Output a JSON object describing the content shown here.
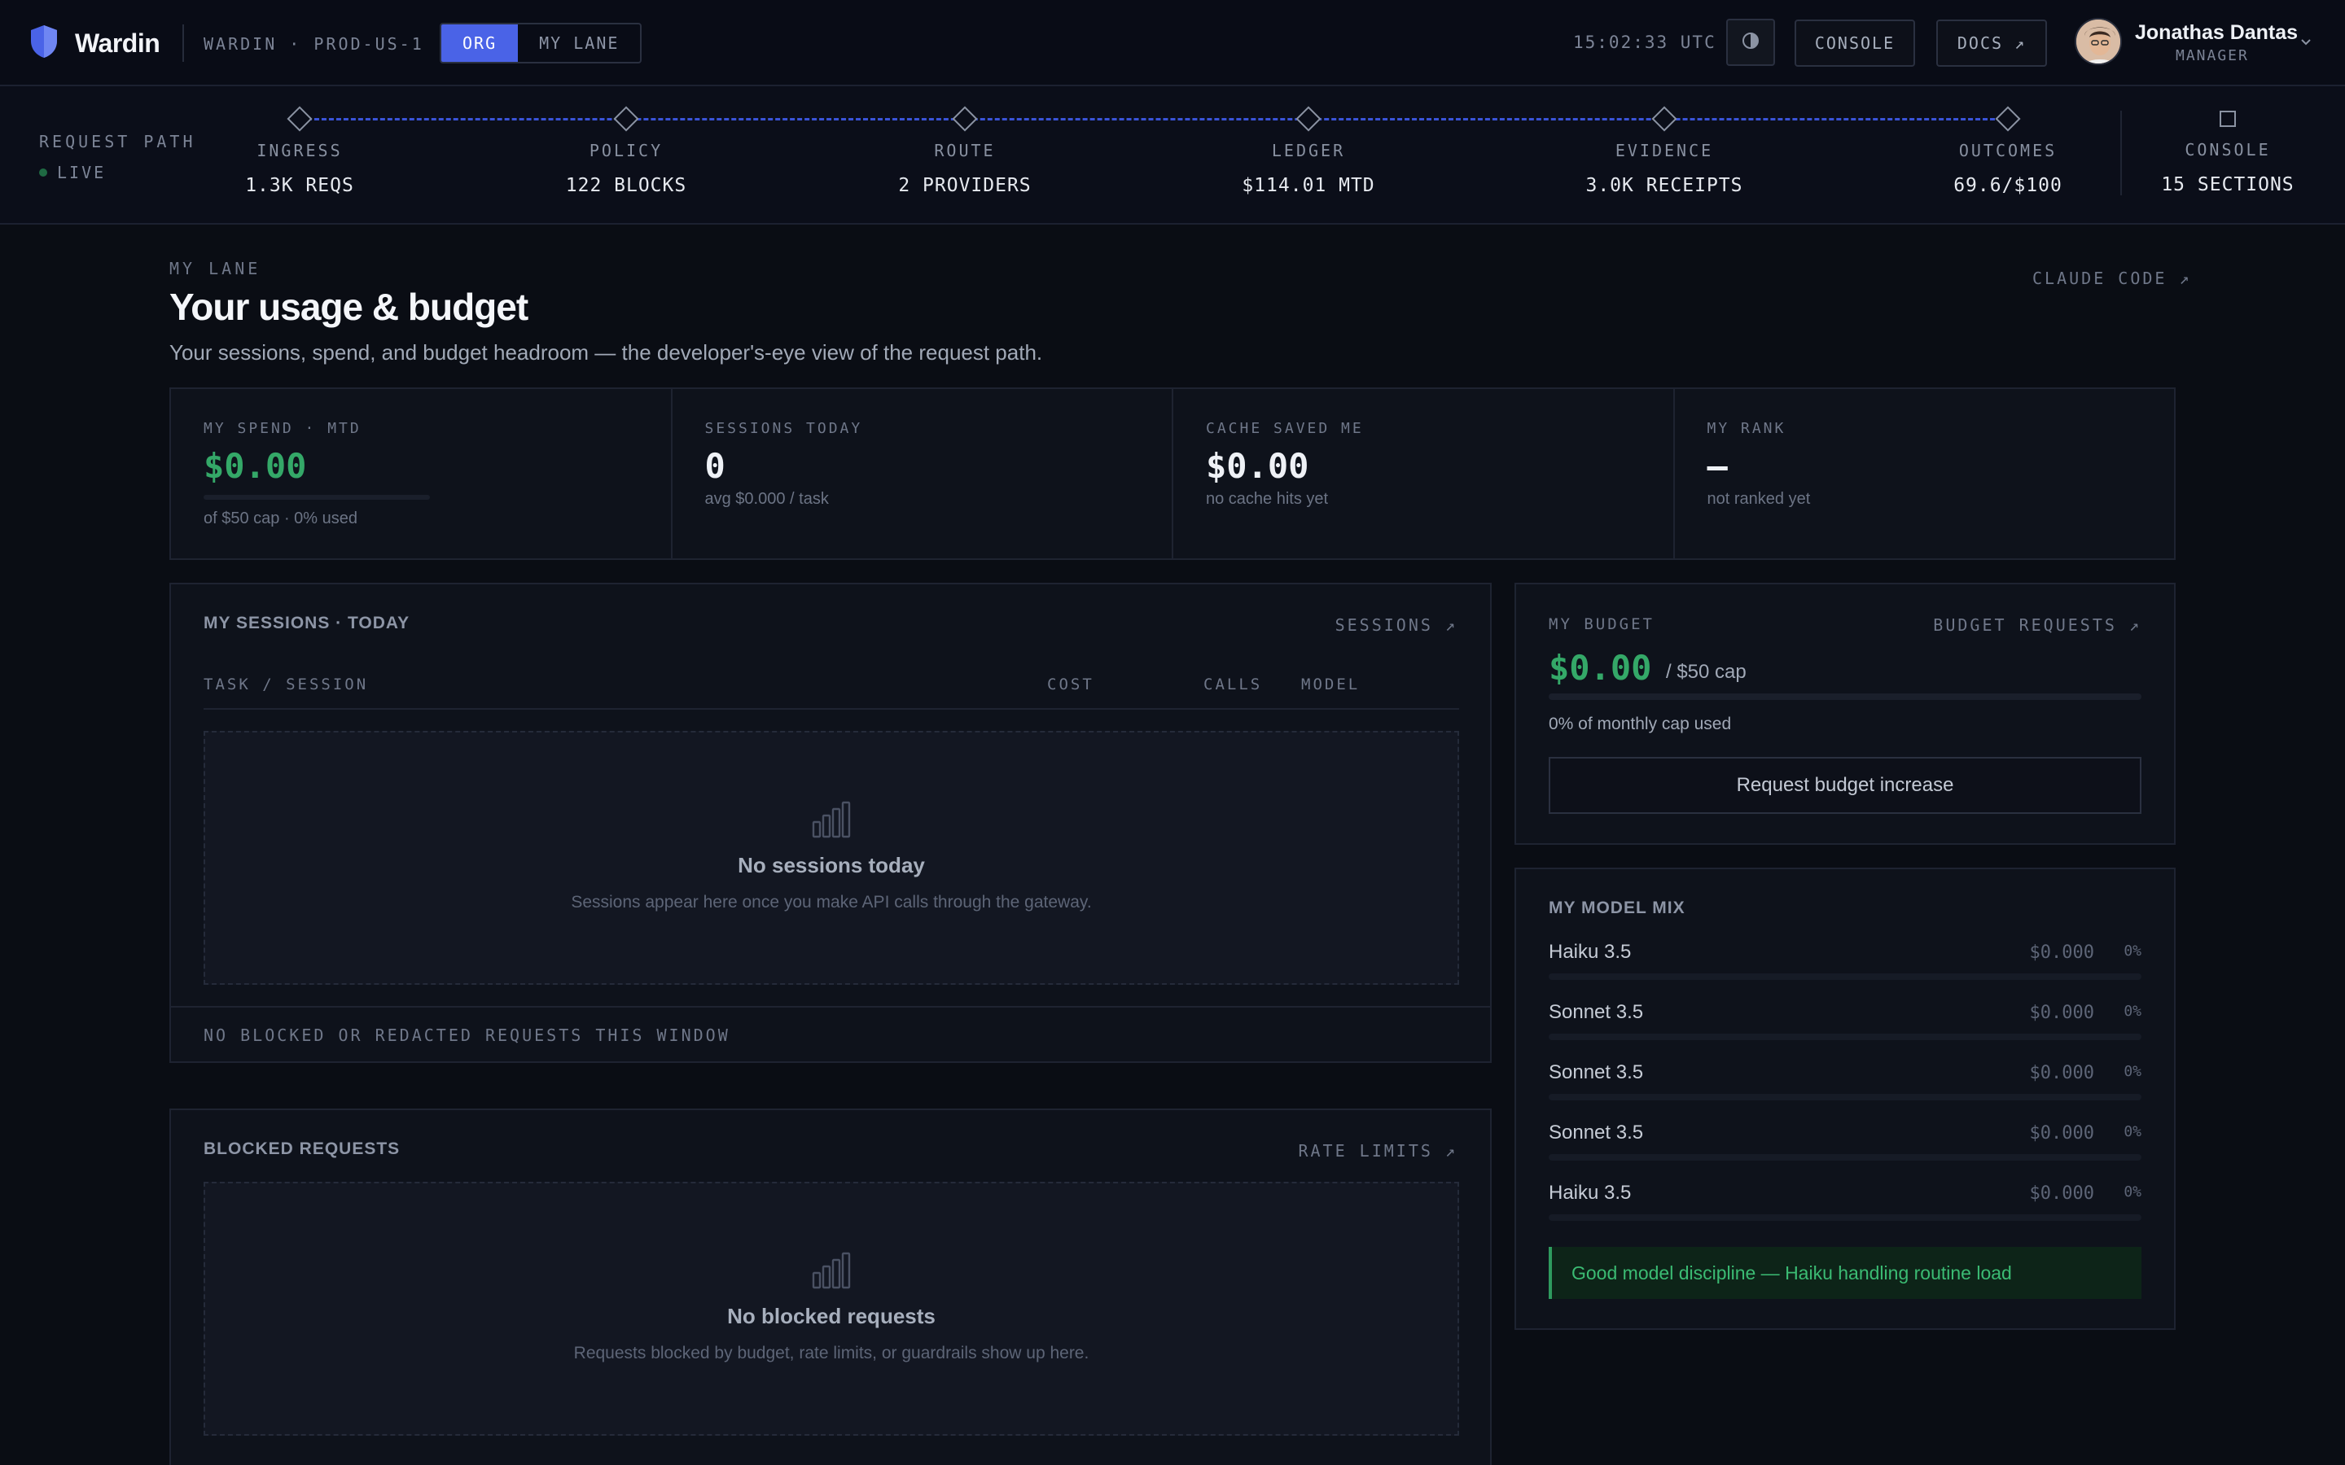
{
  "app": {
    "name": "Wardin",
    "environment": "WARDIN · PROD-US-1"
  },
  "scope": {
    "options": [
      "ORG",
      "MY LANE"
    ],
    "selected": "ORG"
  },
  "topbar": {
    "clock": "15:02:33 UTC",
    "theme_icon": "contrast-icon",
    "console_label": "CONSOLE",
    "docs_label": "DOCS ↗"
  },
  "user": {
    "name": "Jonathas Dantas",
    "role": "MANAGER"
  },
  "request_path": {
    "title": "REQUEST PATH",
    "status": "LIVE",
    "stages": [
      {
        "label": "INGRESS",
        "value": "1.3K REQS"
      },
      {
        "label": "POLICY",
        "value": "122 BLOCKS"
      },
      {
        "label": "ROUTE",
        "value": "2 PROVIDERS"
      },
      {
        "label": "LEDGER",
        "value": "$114.01 MTD"
      },
      {
        "label": "EVIDENCE",
        "value": "3.0K RECEIPTS"
      },
      {
        "label": "OUTCOMES",
        "value": "69.6/$100"
      }
    ],
    "console": {
      "label": "CONSOLE",
      "value": "15 SECTIONS"
    }
  },
  "header": {
    "eyebrow": "MY LANE",
    "title": "Your usage & budget",
    "subtitle": "Your sessions, spend, and budget headroom — the developer's-eye view of the request path.",
    "link": "CLAUDE CODE ↗"
  },
  "kpis": [
    {
      "label": "MY SPEND · MTD",
      "value": "$0.00",
      "sub": "of $50 cap · 0% used",
      "progress": 0
    },
    {
      "label": "SESSIONS TODAY",
      "value": "0",
      "sub": "avg $0.000 / task"
    },
    {
      "label": "CACHE SAVED ME",
      "value": "$0.00",
      "sub": "no cache hits yet"
    },
    {
      "label": "MY RANK",
      "value": "—",
      "sub": "not ranked yet"
    }
  ],
  "sessions": {
    "title": "MY SESSIONS · TODAY",
    "link": "SESSIONS ↗",
    "columns": [
      "TASK / SESSION",
      "COST",
      "CALLS",
      "MODEL"
    ],
    "empty_title": "No sessions today",
    "empty_desc": "Sessions appear here once you make API calls through the gateway.",
    "footer": "NO BLOCKED OR REDACTED REQUESTS THIS WINDOW"
  },
  "blocked": {
    "title": "BLOCKED REQUESTS",
    "link": "RATE LIMITS ↗",
    "empty_title": "No blocked requests",
    "empty_desc": "Requests blocked by budget, rate limits, or guardrails show up here."
  },
  "budget": {
    "label": "MY BUDGET",
    "link": "BUDGET REQUESTS ↗",
    "value": "$0.00",
    "cap": "/ $50 cap",
    "used": "0% of monthly cap used",
    "progress": 0,
    "button": "Request budget increase"
  },
  "model_mix": {
    "title": "MY MODEL MIX",
    "rows": [
      {
        "name": "Haiku 3.5",
        "cost": "$0.000",
        "pct": "0%"
      },
      {
        "name": "Sonnet 3.5",
        "cost": "$0.000",
        "pct": "0%"
      },
      {
        "name": "Sonnet 3.5",
        "cost": "$0.000",
        "pct": "0%"
      },
      {
        "name": "Sonnet 3.5",
        "cost": "$0.000",
        "pct": "0%"
      },
      {
        "name": "Haiku 3.5",
        "cost": "$0.000",
        "pct": "0%"
      }
    ],
    "note": "Good model discipline — Haiku handling routine load"
  },
  "colors": {
    "accent": "#4a63e7",
    "positive": "#34a868",
    "background": "#0a0d14"
  }
}
